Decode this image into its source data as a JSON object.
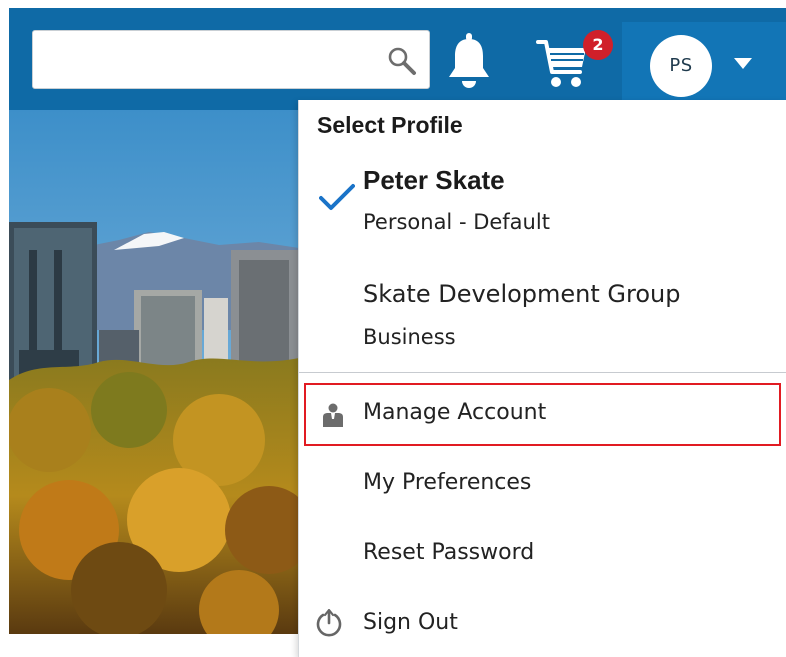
{
  "header": {
    "search": {
      "value": "",
      "placeholder": ""
    },
    "icons": {
      "search": "search-icon",
      "notifications": "bell-icon",
      "cart": "cart-icon",
      "menu": "chevron-down-icon"
    },
    "cart_count": "2",
    "avatar_initials": "PS"
  },
  "profile_menu": {
    "title": "Select Profile",
    "profiles": [
      {
        "name": "Peter Skate",
        "subtitle": "Personal - Default",
        "selected": true
      },
      {
        "name": "Skate Development Group",
        "subtitle": "Business",
        "selected": false
      }
    ],
    "items": [
      {
        "label": "Manage Account",
        "icon": "person-icon",
        "highlighted": true
      },
      {
        "label": "My Preferences",
        "icon": ""
      },
      {
        "label": "Reset Password",
        "icon": ""
      },
      {
        "label": "Sign Out",
        "icon": "power-icon"
      }
    ]
  },
  "colors": {
    "header_bg": "#0f6aa6",
    "profile_bg": "#1275b6",
    "badge": "#d0202a",
    "highlight_border": "#e11b22",
    "check": "#1a73c8"
  }
}
